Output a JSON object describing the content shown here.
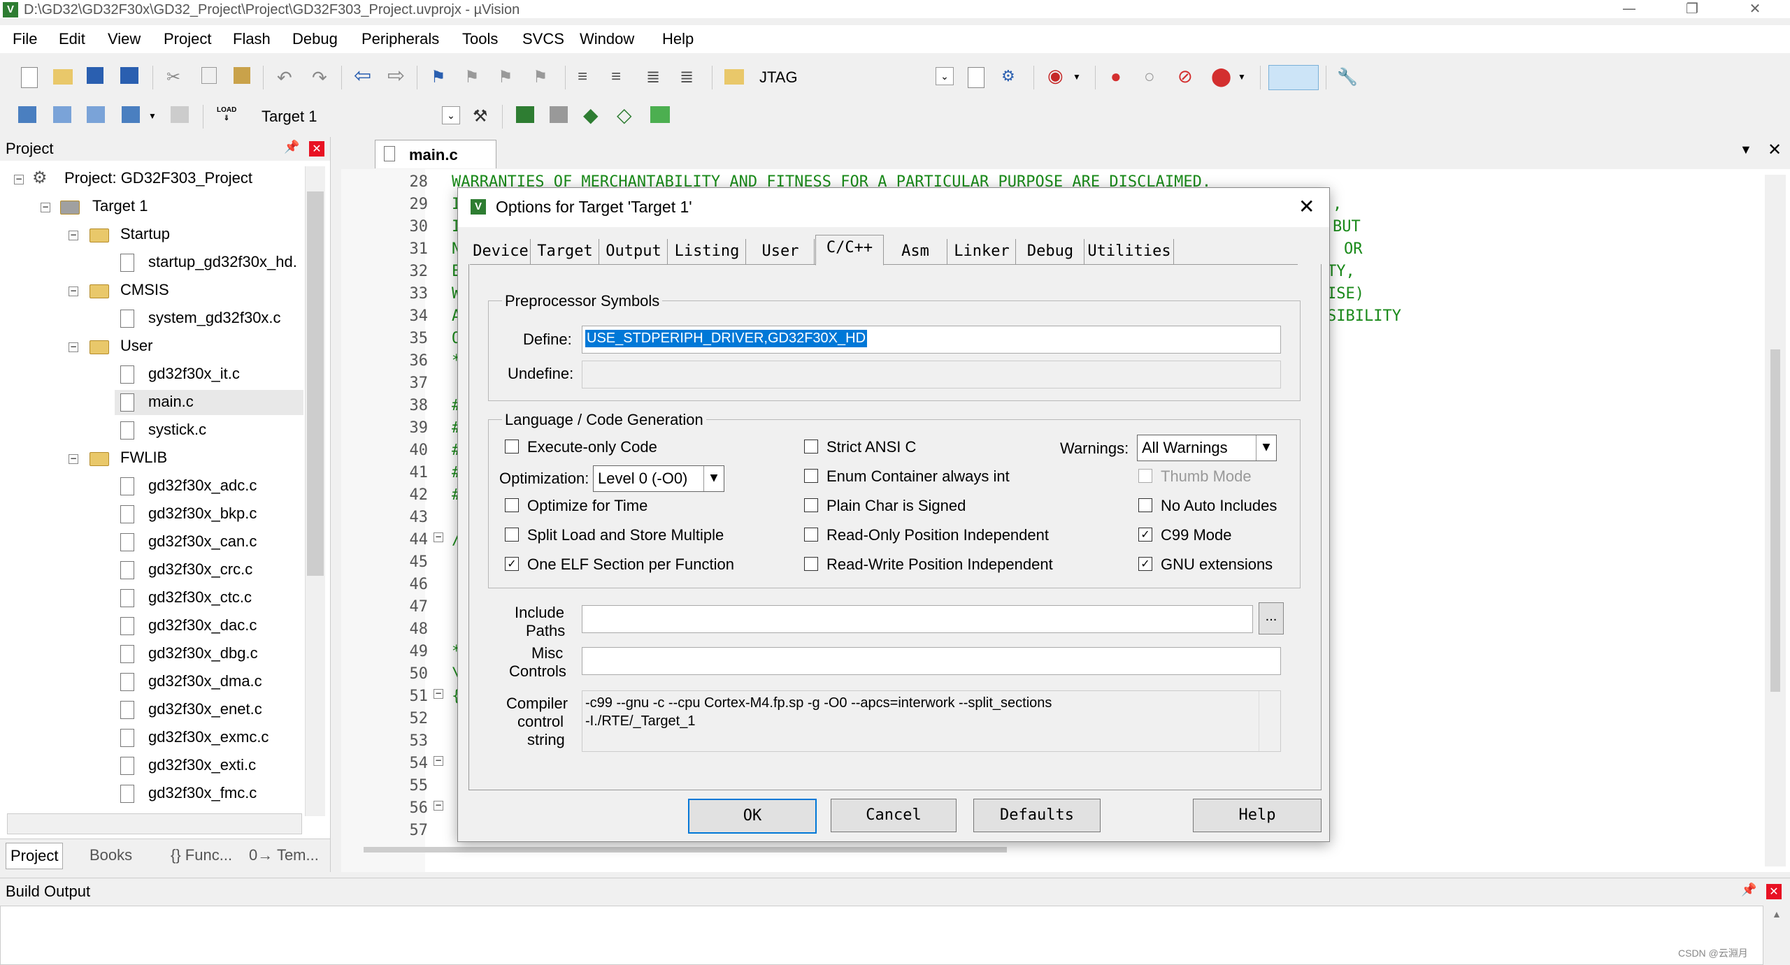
{
  "window": {
    "title": "D:\\GD32\\GD32F30x\\GD32_Project\\Project\\GD32F303_Project.uvprojx - µVision",
    "app_icon": "V"
  },
  "menu": [
    "File",
    "Edit",
    "View",
    "Project",
    "Flash",
    "Debug",
    "Peripherals",
    "Tools",
    "SVCS",
    "Window",
    "Help"
  ],
  "toolbar1": {
    "debug_adapter": "JTAG"
  },
  "toolbar2": {
    "target": "Target 1"
  },
  "project_panel": {
    "title": "Project",
    "root": "Project: GD32F303_Project",
    "target": "Target 1",
    "groups": [
      {
        "name": "Startup",
        "files": [
          "startup_gd32f30x_hd."
        ]
      },
      {
        "name": "CMSIS",
        "files": [
          "system_gd32f30x.c"
        ]
      },
      {
        "name": "User",
        "files": [
          "gd32f30x_it.c",
          "main.c",
          "systick.c"
        ]
      },
      {
        "name": "FWLIB",
        "files": [
          "gd32f30x_adc.c",
          "gd32f30x_bkp.c",
          "gd32f30x_can.c",
          "gd32f30x_crc.c",
          "gd32f30x_ctc.c",
          "gd32f30x_dac.c",
          "gd32f30x_dbg.c",
          "gd32f30x_dma.c",
          "gd32f30x_enet.c",
          "gd32f30x_exmc.c",
          "gd32f30x_exti.c",
          "gd32f30x_fmc.c"
        ]
      }
    ],
    "bottom_tabs": [
      "Project",
      "Books",
      "{} Func...",
      "0→ Tem..."
    ]
  },
  "editor": {
    "tab": "main.c",
    "line_numbers": [
      "28",
      "29",
      "30",
      "31",
      "32",
      "33",
      "34",
      "35",
      "36",
      "37",
      "38",
      "39",
      "40",
      "41",
      "42",
      "43",
      "44",
      "45",
      "46",
      "47",
      "48",
      "49",
      "50",
      "51",
      "52",
      "53",
      "54",
      "55",
      "56",
      "57"
    ],
    "line28": "WARRANTIES OF MERCHANTABILITY AND FITNESS FOR A PARTICULAR PURPOSE ARE DISCLAIMED.",
    "right_fragments": [
      ",",
      "BUT",
      "OR",
      "TY,",
      "ISE)",
      "SIBILITY"
    ],
    "left_fragments": [
      "I",
      "I",
      "I",
      "N",
      "E",
      "W",
      "A",
      "O",
      "*",
      "#",
      "#",
      "#",
      "#",
      "#",
      "/",
      "*",
      "\\",
      "{"
    ]
  },
  "dialog": {
    "title": "Options for Target 'Target 1'",
    "tabs": [
      "Device",
      "Target",
      "Output",
      "Listing",
      "User",
      "C/C++",
      "Asm",
      "Linker",
      "Debug",
      "Utilities"
    ],
    "active_tab": "C/C++",
    "preprocessor": {
      "title": "Preprocessor Symbols",
      "define_label": "Define:",
      "define_value": "USE_STDPERIPH_DRIVER,GD32F30X_HD",
      "undefine_label": "Undefine:",
      "undefine_value": ""
    },
    "codegen": {
      "title": "Language / Code Generation",
      "execute_only": "Execute-only Code",
      "optimization_label": "Optimization:",
      "optimization_value": "Level 0 (-O0)",
      "optimize_time": "Optimize for Time",
      "split_load": "Split Load and Store Multiple",
      "one_elf": "One ELF Section per Function",
      "strict_ansi": "Strict ANSI C",
      "enum_container": "Enum Container always int",
      "plain_char": "Plain Char is Signed",
      "ro_pi": "Read-Only Position Independent",
      "rw_pi": "Read-Write Position Independent",
      "warnings_label": "Warnings:",
      "warnings_value": "All Warnings",
      "thumb_mode": "Thumb Mode",
      "no_auto_includes": "No Auto Includes",
      "c99_mode": "C99 Mode",
      "gnu_ext": "GNU extensions"
    },
    "include_label_1": "Include",
    "include_label_2": "Paths",
    "include_value": "",
    "browse": "...",
    "misc_label_1": "Misc",
    "misc_label_2": "Controls",
    "misc_value": "",
    "compiler_label_1": "Compiler",
    "compiler_label_2": "control",
    "compiler_label_3": "string",
    "compiler_line1": "-c99 --gnu -c --cpu Cortex-M4.fp.sp -g -O0 --apcs=interwork --split_sections",
    "compiler_line2": "-I./RTE/_Target_1",
    "buttons": {
      "ok": "OK",
      "cancel": "Cancel",
      "defaults": "Defaults",
      "help": "Help"
    },
    "close": "✕"
  },
  "build_output": {
    "title": "Build Output"
  },
  "watermark": "CSDN @云淵月",
  "colors": {
    "selection": "#0078d7",
    "code_comment": "#1a8a1a",
    "close_red": "#e81123"
  }
}
